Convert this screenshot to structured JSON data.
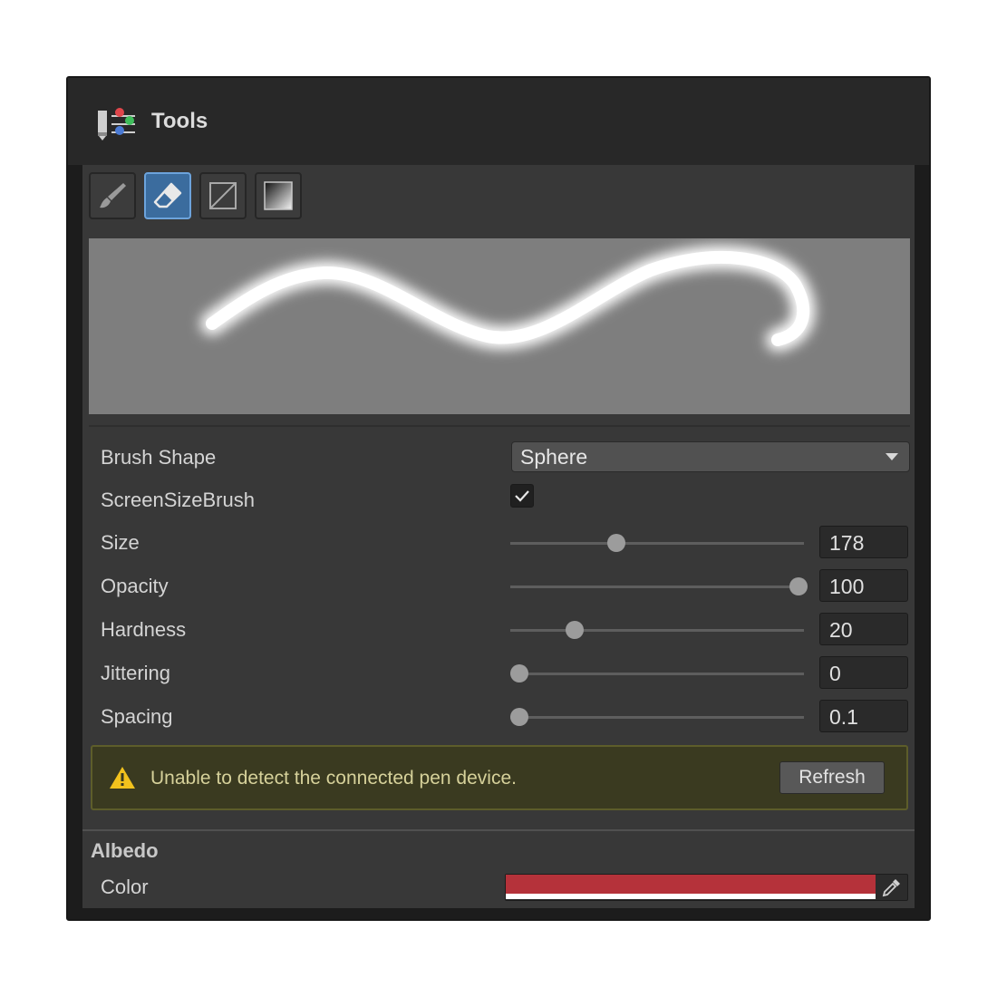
{
  "header": {
    "title": "Tools"
  },
  "toolbar": {
    "buttons": [
      {
        "name": "paint-brush-tool",
        "icon": "brush-icon",
        "active": false
      },
      {
        "name": "eraser-tool",
        "icon": "eraser-icon",
        "active": true
      },
      {
        "name": "clear-tool",
        "icon": "square-slash-icon",
        "active": false
      },
      {
        "name": "gradient-tool",
        "icon": "gradient-icon",
        "active": false
      }
    ]
  },
  "properties": {
    "brush_shape": {
      "label": "Brush Shape",
      "value": "Sphere"
    },
    "screen_size_brush": {
      "label": "ScreenSizeBrush",
      "checked": true
    },
    "sliders": [
      {
        "label": "Size",
        "value": "178",
        "fraction": 0.36
      },
      {
        "label": "Opacity",
        "value": "100",
        "fraction": 0.98
      },
      {
        "label": "Hardness",
        "value": "20",
        "fraction": 0.22
      },
      {
        "label": "Jittering",
        "value": "0",
        "fraction": 0.03
      },
      {
        "label": "Spacing",
        "value": "0.1",
        "fraction": 0.03
      }
    ]
  },
  "warning": {
    "icon": "warning-icon",
    "message": "Unable to detect the connected pen device.",
    "button_label": "Refresh"
  },
  "albedo": {
    "section_title": "Albedo",
    "color_label": "Color",
    "color_value": "#b5323a"
  },
  "colors": {
    "accent": "#3b6c9e",
    "warning_text": "#d6d19a",
    "warning_icon": "#f2c21d"
  }
}
